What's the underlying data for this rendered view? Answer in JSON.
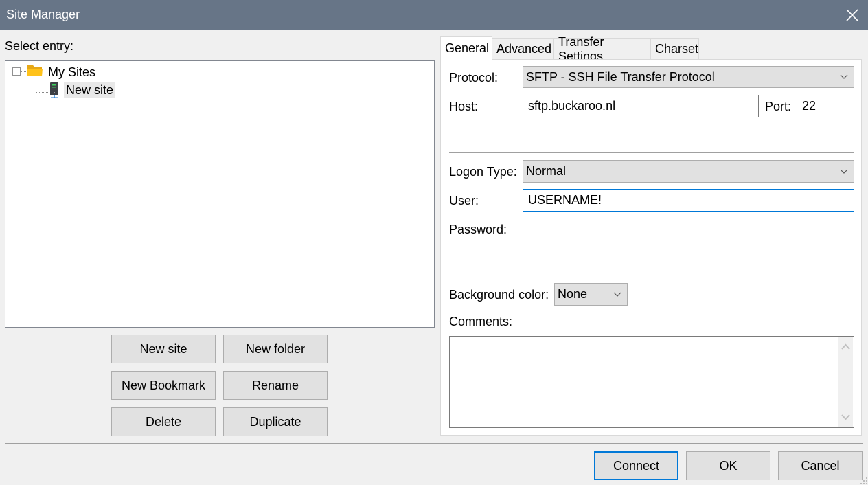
{
  "window": {
    "title": "Site Manager",
    "close_icon": "close-icon"
  },
  "left": {
    "select_entry_label": "Select entry:",
    "tree": [
      {
        "label": "My Sites",
        "icon": "folder-icon",
        "expanded": true,
        "children": [
          {
            "label": "New site",
            "icon": "server-icon",
            "selected": true
          }
        ]
      }
    ],
    "buttons": {
      "new_site": "New site",
      "new_folder": "New folder",
      "new_bookmark": "New Bookmark",
      "rename": "Rename",
      "delete": "Delete",
      "duplicate": "Duplicate"
    }
  },
  "tabs": [
    {
      "label": "General",
      "active": true
    },
    {
      "label": "Advanced",
      "active": false
    },
    {
      "label": "Transfer Settings",
      "active": false
    },
    {
      "label": "Charset",
      "active": false
    }
  ],
  "general": {
    "protocol_label": "Protocol:",
    "protocol_value": "SFTP - SSH File Transfer Protocol",
    "host_label": "Host:",
    "host_value": "sftp.buckaroo.nl",
    "port_label": "Port:",
    "port_value": "22",
    "logon_type_label": "Logon Type:",
    "logon_type_value": "Normal",
    "user_label": "User:",
    "user_value": "USERNAME!",
    "password_label": "Password:",
    "password_value": "",
    "bg_color_label": "Background color:",
    "bg_color_value": "None",
    "comments_label": "Comments:",
    "comments_value": ""
  },
  "footer": {
    "connect": "Connect",
    "ok": "OK",
    "cancel": "Cancel"
  },
  "colors": {
    "titlebar": "#677587",
    "focus_accent": "#0078d7",
    "folder": "#f5b800"
  }
}
